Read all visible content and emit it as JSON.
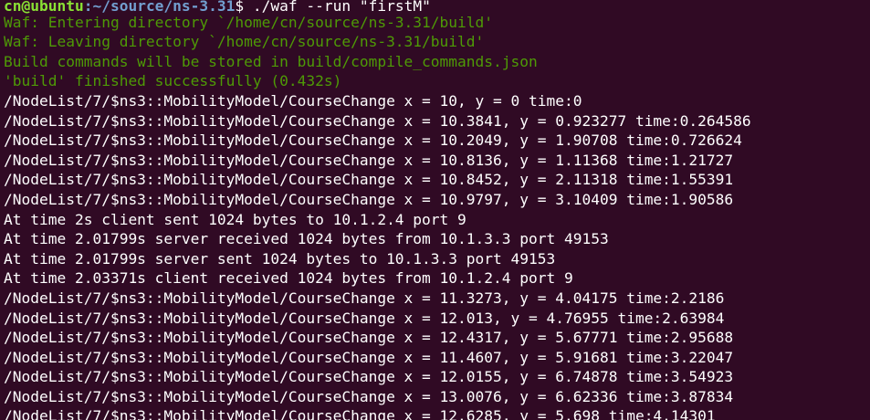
{
  "prompt": {
    "user_host": "cn@ubuntu",
    "path": ":~/source/ns-3.31",
    "symbol": "$ ",
    "command": "./waf --run \"firstM\""
  },
  "output_lines": [
    {
      "text": "Waf: Entering directory `/home/cn/source/ns-3.31/build'",
      "color": "#4e9a06"
    },
    {
      "text": "Waf: Leaving directory `/home/cn/source/ns-3.31/build'",
      "color": "#4e9a06"
    },
    {
      "text": "Build commands will be stored in build/compile_commands.json",
      "color": "#4e9a06"
    },
    {
      "text": "'build' finished successfully (0.432s)",
      "color": "#4e9a06"
    },
    {
      "text": "/NodeList/7/$ns3::MobilityModel/CourseChange x = 10, y = 0 time:0",
      "color": "#ffffff"
    },
    {
      "text": "/NodeList/7/$ns3::MobilityModel/CourseChange x = 10.3841, y = 0.923277 time:0.264586",
      "color": "#ffffff"
    },
    {
      "text": "/NodeList/7/$ns3::MobilityModel/CourseChange x = 10.2049, y = 1.90708 time:0.726624",
      "color": "#ffffff"
    },
    {
      "text": "/NodeList/7/$ns3::MobilityModel/CourseChange x = 10.8136, y = 1.11368 time:1.21727",
      "color": "#ffffff"
    },
    {
      "text": "/NodeList/7/$ns3::MobilityModel/CourseChange x = 10.8452, y = 2.11318 time:1.55391",
      "color": "#ffffff"
    },
    {
      "text": "/NodeList/7/$ns3::MobilityModel/CourseChange x = 10.9797, y = 3.10409 time:1.90586",
      "color": "#ffffff"
    },
    {
      "text": "At time 2s client sent 1024 bytes to 10.1.2.4 port 9",
      "color": "#ffffff"
    },
    {
      "text": "At time 2.01799s server received 1024 bytes from 10.1.3.3 port 49153",
      "color": "#ffffff"
    },
    {
      "text": "At time 2.01799s server sent 1024 bytes to 10.1.3.3 port 49153",
      "color": "#ffffff"
    },
    {
      "text": "At time 2.03371s client received 1024 bytes from 10.1.2.4 port 9",
      "color": "#ffffff"
    },
    {
      "text": "/NodeList/7/$ns3::MobilityModel/CourseChange x = 11.3273, y = 4.04175 time:2.2186",
      "color": "#ffffff"
    },
    {
      "text": "/NodeList/7/$ns3::MobilityModel/CourseChange x = 12.013, y = 4.76955 time:2.63984",
      "color": "#ffffff"
    },
    {
      "text": "/NodeList/7/$ns3::MobilityModel/CourseChange x = 12.4317, y = 5.67771 time:2.95688",
      "color": "#ffffff"
    },
    {
      "text": "/NodeList/7/$ns3::MobilityModel/CourseChange x = 11.4607, y = 5.91681 time:3.22047",
      "color": "#ffffff"
    },
    {
      "text": "/NodeList/7/$ns3::MobilityModel/CourseChange x = 12.0155, y = 6.74878 time:3.54923",
      "color": "#ffffff"
    },
    {
      "text": "/NodeList/7/$ns3::MobilityModel/CourseChange x = 13.0076, y = 6.62336 time:3.87834",
      "color": "#ffffff"
    },
    {
      "text": "/NodeList/7/$ns3::MobilityModel/CourseChange x = 12.6285, y = 5.698 time:4.14301",
      "color": "#ffffff"
    }
  ]
}
